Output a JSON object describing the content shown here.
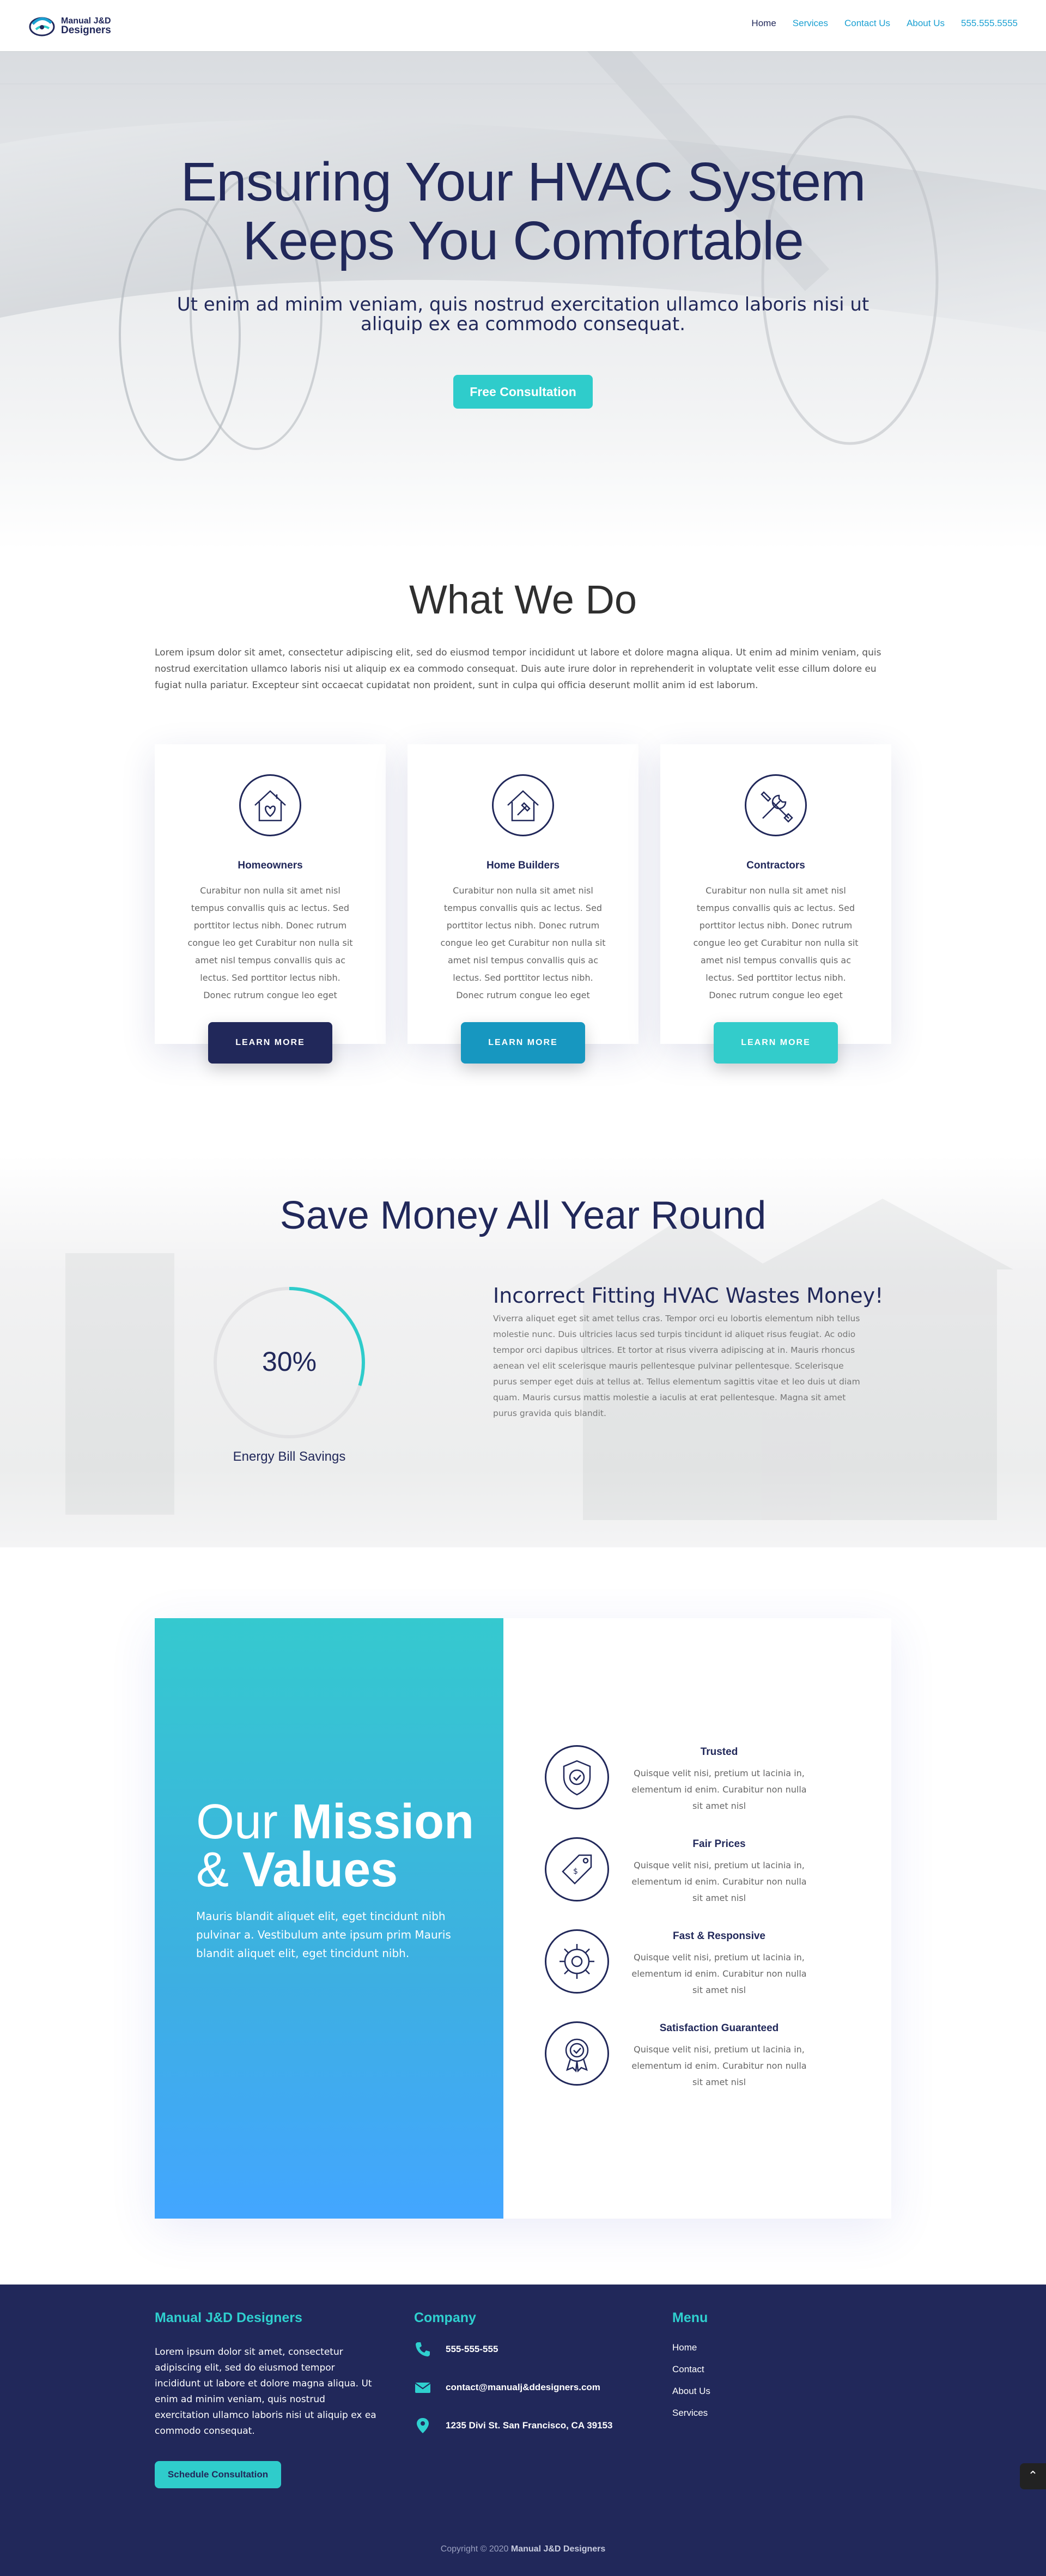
{
  "header": {
    "logo_line1": "Manual J&D",
    "logo_line2": "Designers",
    "nav": [
      "Home",
      "Services",
      "Contact Us",
      "About Us",
      "555.555.5555"
    ]
  },
  "hero": {
    "title_line1": "Ensuring Your HVAC System",
    "title_line2": "Keeps You Comfortable",
    "subtitle": "Ut enim ad minim veniam, quis nostrud exercitation ullamco laboris nisi ut aliquip ex ea commodo consequat.",
    "button": "Free Consultation"
  },
  "what_we_do": {
    "title": "What We Do",
    "text": "Lorem ipsum dolor sit amet, consectetur adipiscing elit, sed do eiusmod tempor incididunt ut labore et dolore magna aliqua. Ut enim ad minim veniam, quis nostrud exercitation ullamco laboris nisi ut aliquip ex ea commodo consequat. Duis aute irure dolor in reprehenderit in voluptate velit esse cillum dolore eu fugiat nulla pariatur. Excepteur sint occaecat cupidatat non proident, sunt in culpa qui officia deserunt mollit anim id est laborum.",
    "cards": [
      {
        "title": "Homeowners",
        "body": "Curabitur non nulla sit amet nisl tempus convallis quis ac lectus. Sed porttitor lectus nibh. Donec rutrum congue leo get Curabitur non nulla sit amet nisl tempus convallis quis ac lectus. Sed porttitor lectus nibh. Donec rutrum congue leo eget",
        "button": "LEARN MORE",
        "icon": "house-heart-icon",
        "color": "#21285a"
      },
      {
        "title": "Home Builders",
        "body": "Curabitur non nulla sit amet nisl tempus convallis quis ac lectus. Sed porttitor lectus nibh. Donec rutrum congue leo get Curabitur non nulla sit amet nisl tempus convallis quis ac lectus. Sed porttitor lectus nibh. Donec rutrum congue leo eget",
        "button": "LEARN MORE",
        "icon": "house-hammer-icon",
        "color": "#1797c0"
      },
      {
        "title": "Contractors",
        "body": "Curabitur non nulla sit amet nisl tempus convallis quis ac lectus. Sed porttitor lectus nibh. Donec rutrum congue leo get Curabitur non nulla sit amet nisl tempus convallis quis ac lectus. Sed porttitor lectus nibh. Donec rutrum congue leo eget",
        "button": "LEARN MORE",
        "icon": "tools-icon",
        "color": "#33cccb"
      }
    ]
  },
  "save": {
    "title": "Save Money All Year Round",
    "gauge_value": "30%",
    "gauge_fraction": 0.3,
    "gauge_label": "Energy Bill Savings",
    "heading": "Incorrect Fitting HVAC Wastes Money!",
    "text": "Viverra aliquet eget sit amet tellus cras. Tempor orci eu lobortis elementum nibh tellus molestie nunc. Duis ultricies lacus sed turpis tincidunt id aliquet risus feugiat. Ac odio tempor orci dapibus ultrices. Et tortor at risus viverra adipiscing at in. Mauris rhoncus aenean vel elit scelerisque mauris pellentesque pulvinar pellentesque. Scelerisque purus semper eget duis at tellus at. Tellus elementum sagittis vitae et leo duis ut diam quam. Mauris cursus mattis molestie a iaculis at erat pellentesque. Magna sit amet purus gravida quis blandit."
  },
  "mission": {
    "h_part1": "Our ",
    "h_part2": "Mission",
    "h_part3": "& ",
    "h_part4": "Values",
    "text": "Mauris blandit aliquet elit, eget tincidunt nibh pulvinar a. Vestibulum ante ipsum prim Mauris blandit aliquet elit, eget tincidunt nibh.",
    "values": [
      {
        "title": "Trusted",
        "body": "Quisque velit nisi, pretium ut lacinia in, elementum id enim. Curabitur non nulla sit amet nisl",
        "icon": "shield-check-icon"
      },
      {
        "title": "Fair Prices",
        "body": "Quisque velit nisi, pretium ut lacinia in, elementum id enim. Curabitur non nulla sit amet nisl",
        "icon": "price-tag-icon"
      },
      {
        "title": "Fast & Responsive",
        "body": "Quisque velit nisi, pretium ut lacinia in, elementum id enim. Curabitur non nulla sit amet nisl",
        "icon": "gear-icon"
      },
      {
        "title": "Satisfaction Guaranteed",
        "body": "Quisque velit nisi, pretium ut lacinia in, elementum id enim. Curabitur non nulla sit amet nisl",
        "icon": "award-badge-icon"
      }
    ]
  },
  "footer": {
    "col1_title": "Manual J&D Designers",
    "col1_text": "Lorem ipsum dolor sit amet, consectetur adipiscing elit, sed do eiusmod tempor incididunt ut labore et dolore magna aliqua. Ut enim ad minim veniam, quis nostrud exercitation ullamco laboris nisi ut aliquip ex ea commodo consequat.",
    "col1_button": "Schedule Consultation",
    "col2_title": "Company",
    "phone": "555-555-555",
    "email": "contact@manualj&ddesigners.com",
    "address": "1235 Divi St. San Francisco, CA 39153",
    "col3_title": "Menu",
    "menu": [
      "Home",
      "Contact",
      "About Us",
      "Services"
    ],
    "copyright_prefix": "Copyright © 2020 ",
    "copyright_brand": "Manual J&D Designers"
  },
  "colors": {
    "navy": "#21285a",
    "teal": "#2fcccb",
    "blue": "#1aa0d2",
    "mission_top": "#35c9cf",
    "mission_bottom": "#43a6ff"
  }
}
